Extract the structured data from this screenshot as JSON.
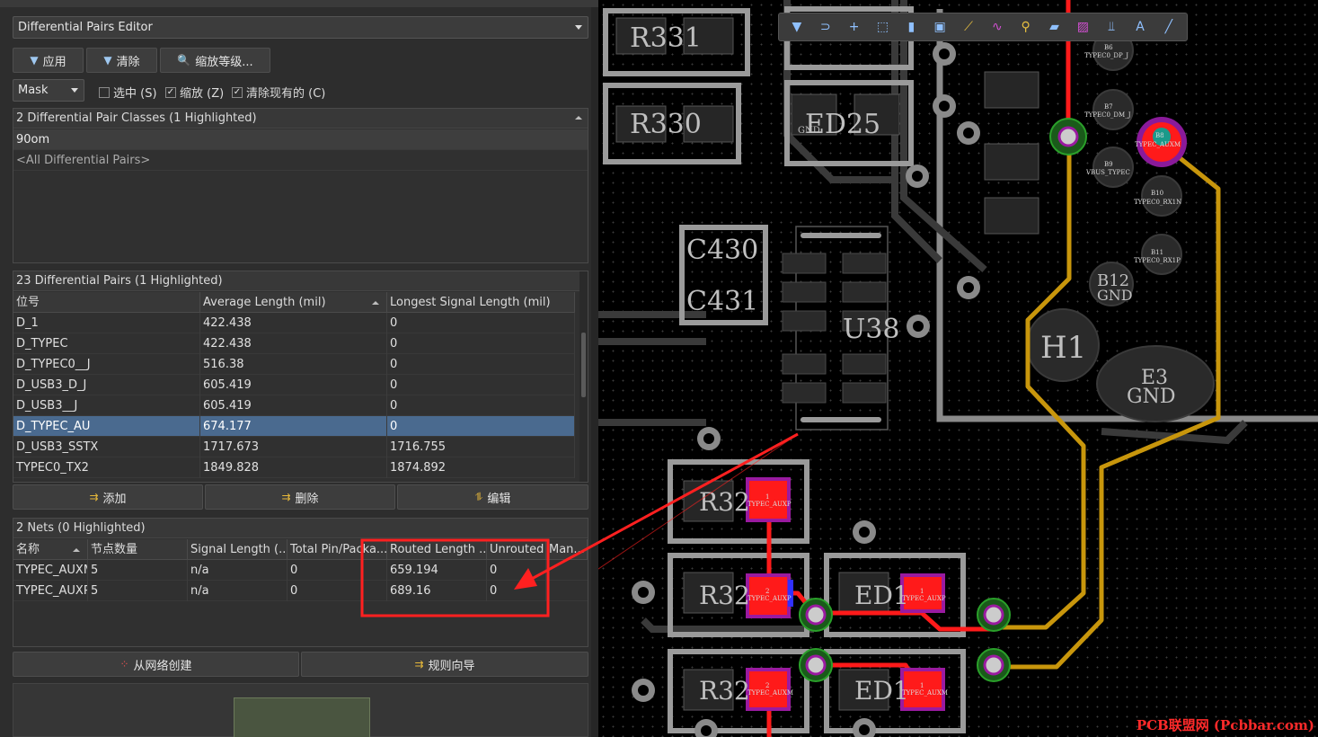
{
  "panel": {
    "title": "Differential Pairs Editor",
    "toolbar": {
      "apply": "应用",
      "clear": "清除",
      "zoom": "缩放等级..."
    },
    "mask": {
      "value": "Mask",
      "options": [
        {
          "label": "选中 (S)",
          "checked": false
        },
        {
          "label": "缩放 (Z)",
          "checked": true
        },
        {
          "label": "清除现有的 (C)",
          "checked": true
        }
      ]
    },
    "classes": {
      "header": "2 Differential Pair Classes (1 Highlighted)",
      "items": [
        "90om",
        "<All Differential Pairs>"
      ]
    },
    "pairs": {
      "header": "23 Differential Pairs (1 Highlighted)",
      "columns": [
        "位号",
        "Average Length (mil)",
        "Longest Signal Length (mil)"
      ],
      "rows": [
        {
          "name": "D_1",
          "avg": "422.438",
          "longest": "0"
        },
        {
          "name": "D_TYPEC",
          "avg": "422.438",
          "longest": "0"
        },
        {
          "name": "D_TYPEC0__J",
          "avg": "516.38",
          "longest": "0"
        },
        {
          "name": "D_USB3_D_J",
          "avg": "605.419",
          "longest": "0"
        },
        {
          "name": "D_USB3__J",
          "avg": "605.419",
          "longest": "0"
        },
        {
          "name": "D_TYPEC_AU",
          "avg": "674.177",
          "longest": "0"
        },
        {
          "name": "D_USB3_SSTX",
          "avg": "1717.673",
          "longest": "1716.755"
        },
        {
          "name": "TYPEC0_TX2",
          "avg": "1849.828",
          "longest": "1874.892"
        }
      ],
      "buttons": {
        "add": "添加",
        "delete": "删除",
        "edit": "编辑"
      }
    },
    "nets": {
      "header": "2 Nets (0 Highlighted)",
      "columns": [
        "名称",
        "节点数量",
        "Signal Length (...",
        "Total Pin/Packa...",
        "Routed Length ...",
        "Unrouted ...",
        "Man..."
      ],
      "rows": [
        {
          "name": "TYPEC_AUXM",
          "nodes": "5",
          "signal": "n/a",
          "total": "0",
          "routed": "659.194",
          "unrouted": "0"
        },
        {
          "name": "TYPEC_AUXP",
          "nodes": "5",
          "signal": "n/a",
          "total": "0",
          "routed": "689.16",
          "unrouted": "0"
        }
      ]
    },
    "bottom_buttons": {
      "from_nets": "从网络创建",
      "rule_wizard": "规则向导"
    }
  },
  "pcb": {
    "labels": {
      "r331": "R331",
      "r330": "R330",
      "ed25": "ED25",
      "c430": "C430",
      "c431": "C431",
      "u38": "U38",
      "h1": "H1",
      "b12": "B12",
      "gnd": "GND",
      "e3": "E3",
      "r3a": "R32",
      "r3b": "R32",
      "r3c": "R32",
      "ed1a": "ED1",
      "ed1b": "ED1",
      "gnd_small": "GND"
    },
    "pins": {
      "b6": "B6",
      "b6net": "TYPEC0_DP_J",
      "b7": "B7",
      "b7net": "TYPEC0_DM_J",
      "b8": "B8",
      "b8net": "TYPEC_AUXM",
      "b9": "B9",
      "b9net": "VBUS_TYPEC",
      "b10": "B10",
      "b10net": "TYPEC0_RX1N",
      "b11": "B11",
      "b11net": "TYPEC0_RX1P",
      "pad_auxp": "TYPEC_AUXP",
      "pad_auxm": "TYPEC_AUXM",
      "n1": "1",
      "n2": "2"
    },
    "watermark": "PCB联盟网 (Pcbbar.com)",
    "colors": {
      "top_trace": "#ff1a1a",
      "bottom_trace": "#c8960c",
      "highlight_box": "#ff2020"
    }
  }
}
